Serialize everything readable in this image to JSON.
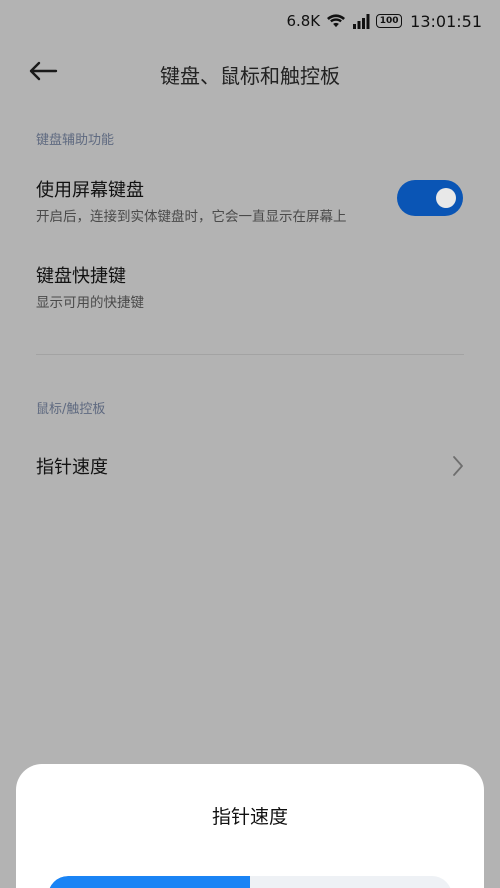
{
  "status_bar": {
    "net_speed": "6.8K",
    "battery": "100",
    "time": "13:01:51"
  },
  "header": {
    "title": "键盘、鼠标和触控板"
  },
  "sections": {
    "keyboard_label": "键盘辅助功能",
    "mouse_label": "鼠标/触控板"
  },
  "items": {
    "screen_keyboard": {
      "title": "使用屏幕键盘",
      "subtitle": "开启后，连接到实体键盘时，它会一直显示在屏幕上",
      "enabled": true
    },
    "shortcuts": {
      "title": "键盘快捷键",
      "subtitle": "显示可用的快捷键"
    },
    "pointer_speed": {
      "title": "指针速度"
    }
  },
  "sheet": {
    "title": "指针速度",
    "slider_value": 0.5
  },
  "colors": {
    "accent": "#0a55b5",
    "slider_fill": "#1a84f5",
    "background_dim": "#b3b3b3"
  }
}
